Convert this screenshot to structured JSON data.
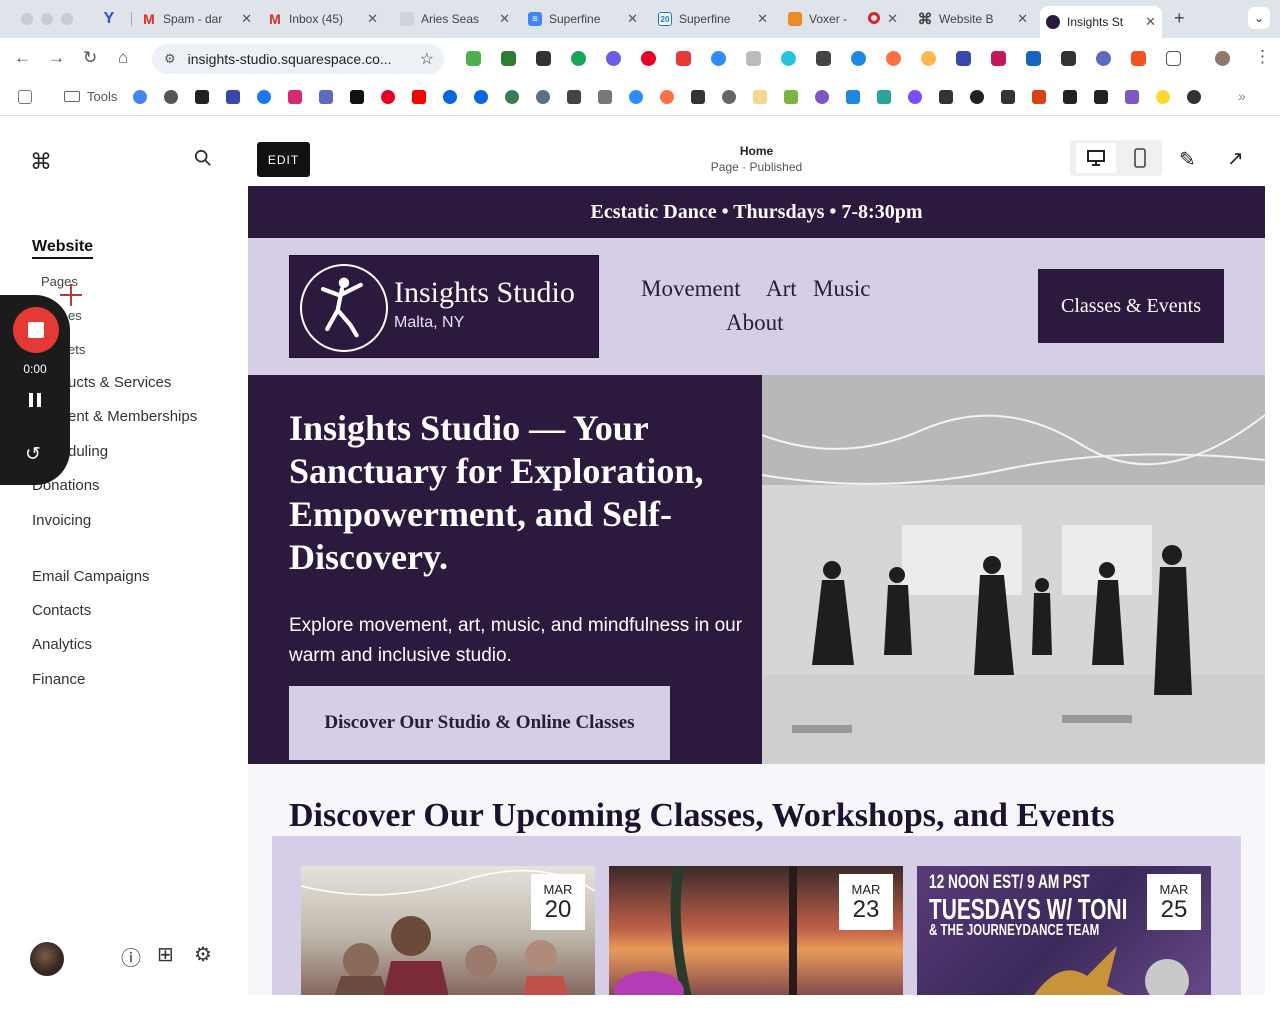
{
  "browser": {
    "tabs": [
      {
        "label": "",
        "icon": "vivaldi-icon"
      },
      {
        "label": "Spam - dar",
        "icon": "gmail-icon"
      },
      {
        "label": "Inbox (45)",
        "icon": "gmail-icon"
      },
      {
        "label": "Aries Seas",
        "icon": "page-icon"
      },
      {
        "label": "Superfine",
        "icon": "docs-icon"
      },
      {
        "label": "Superfine",
        "icon": "calendar-icon"
      },
      {
        "label": "Voxer -",
        "icon": "voxer-icon"
      },
      {
        "label": "Website B",
        "icon": "squarespace-icon"
      },
      {
        "label": "Insights St",
        "icon": "insights-icon"
      }
    ],
    "url": "insights-studio.squarespace.co...",
    "bookmarks_folder": "Tools"
  },
  "sidebar": {
    "title": "Website",
    "sub_item": "Pages",
    "items": [
      "es",
      "ets",
      "ucts & Services",
      "ent & Memberships",
      "duling",
      "Donations",
      "Invoicing"
    ],
    "items2": [
      "Email Campaigns",
      "Contacts",
      "Analytics",
      "Finance"
    ]
  },
  "recorder": {
    "time": "0:00"
  },
  "editor": {
    "edit_label": "EDIT",
    "page_title": "Home",
    "page_status": "Page · Published"
  },
  "site": {
    "announcement": "Ecstatic Dance • Thursdays • 7-8:30pm",
    "logo_name": "Insights Studio",
    "logo_location": "Malta, NY",
    "nav": [
      "Movement",
      "Art",
      "Music",
      "About"
    ],
    "header_cta": "Classes & Events",
    "hero_heading": "Insights Studio — Your Sanctuary for Exploration, Empowerment, and Self-Discovery.",
    "hero_text": "Explore movement, art, music, and mindfulness in our warm and inclusive studio.",
    "hero_button": "Discover Our Studio & Online Classes",
    "section_heading": "Discover Our Upcoming Classes, Workshops, and Events",
    "events": [
      {
        "month": "MAR",
        "day": "20"
      },
      {
        "month": "MAR",
        "day": "23"
      },
      {
        "month": "MAR",
        "day": "25",
        "flyer_line1": "12 NOON EST/ 9 AM PST",
        "flyer_line2": "TUESDAYS W/ TONI",
        "flyer_line3": "& THE JOURNEYDANCE TEAM"
      }
    ]
  },
  "colors": {
    "brand_dark": "#2b1a3d",
    "brand_light": "#d6cde6",
    "record_red": "#e53935"
  }
}
